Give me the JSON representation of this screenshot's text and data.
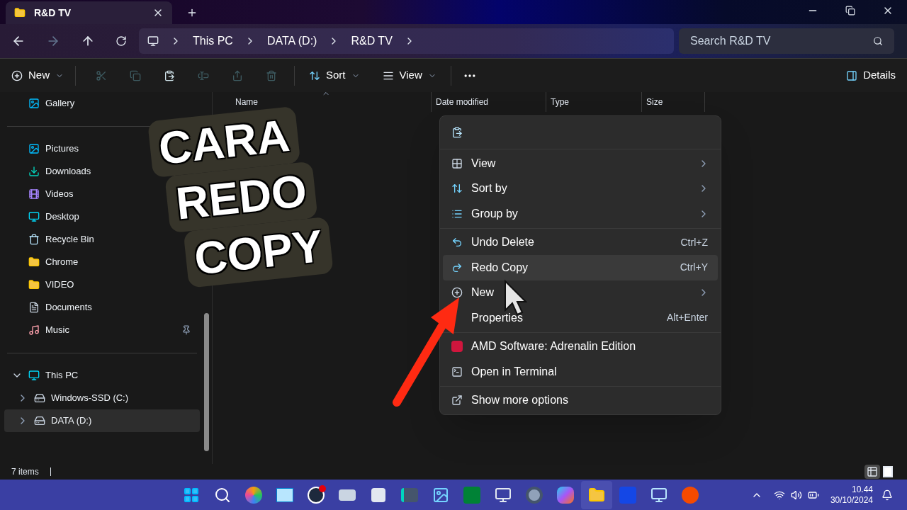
{
  "window": {
    "tab_title": "R&D TV"
  },
  "address": {
    "crumbs": [
      "This PC",
      "DATA (D:)",
      "R&D TV"
    ]
  },
  "search": {
    "placeholder": "Search R&D TV"
  },
  "toolbar": {
    "new": "New",
    "icon_buttons": [
      {
        "disabled": true
      },
      {
        "disabled": true
      },
      {
        "disabled": false
      },
      {
        "disabled": true
      },
      {
        "disabled": true
      },
      {
        "disabled": true
      }
    ],
    "sort": "Sort",
    "view": "View",
    "details": "Details"
  },
  "sidebar": {
    "top": [
      {
        "label": "Gallery",
        "pinned": false
      }
    ],
    "quick": [
      {
        "label": "Pictures",
        "pinned": false
      },
      {
        "label": "Downloads",
        "pinned": false
      },
      {
        "label": "Videos",
        "pinned": false
      },
      {
        "label": "Desktop",
        "pinned": false
      },
      {
        "label": "Recycle Bin",
        "pinned": false
      },
      {
        "label": "Chrome",
        "pinned": false
      },
      {
        "label": "VIDEO",
        "pinned": false
      },
      {
        "label": "Documents",
        "pinned": false
      },
      {
        "label": "Music",
        "pinned": true
      }
    ],
    "tree": [
      {
        "label": "This PC",
        "expanded": true,
        "selected": false,
        "children": [
          {
            "label": "Windows-SSD (C:)",
            "expanded": false,
            "selected": false
          },
          {
            "label": "DATA (D:)",
            "expanded": false,
            "selected": true
          }
        ]
      }
    ]
  },
  "columns": [
    {
      "label": "Name",
      "sorted": true
    },
    {
      "label": "Date modified",
      "sorted": false
    },
    {
      "label": "Type",
      "sorted": false
    },
    {
      "label": "Size",
      "sorted": false
    }
  ],
  "caption": {
    "lines": [
      "CARA",
      "REDO",
      "COPY"
    ]
  },
  "context_menu": {
    "groups": [
      [
        {
          "label": "View",
          "submenu": true,
          "selected": false
        },
        {
          "label": "Sort by",
          "submenu": true,
          "selected": false
        },
        {
          "label": "Group by",
          "submenu": true,
          "selected": false
        }
      ],
      [
        {
          "label": "Undo Delete",
          "shortcut": "Ctrl+Z",
          "submenu": false,
          "selected": false
        },
        {
          "label": "Redo Copy",
          "shortcut": "Ctrl+Y",
          "submenu": false,
          "selected": true
        },
        {
          "label": "New",
          "submenu": true,
          "selected": false
        },
        {
          "label": "Properties",
          "shortcut": "Alt+Enter",
          "submenu": false,
          "selected": false
        }
      ],
      [
        {
          "label": "AMD Software: Adrenalin Edition",
          "submenu": false,
          "selected": false
        },
        {
          "label": "Open in Terminal",
          "submenu": false,
          "selected": false
        }
      ],
      [
        {
          "label": "Show more options",
          "submenu": false,
          "selected": false
        }
      ]
    ]
  },
  "status_bar": {
    "count": "7 items",
    "view_modes": [
      {
        "selected": true
      },
      {
        "selected": false
      }
    ]
  },
  "clock": {
    "time": "10.44",
    "date": "30/10/2024"
  }
}
